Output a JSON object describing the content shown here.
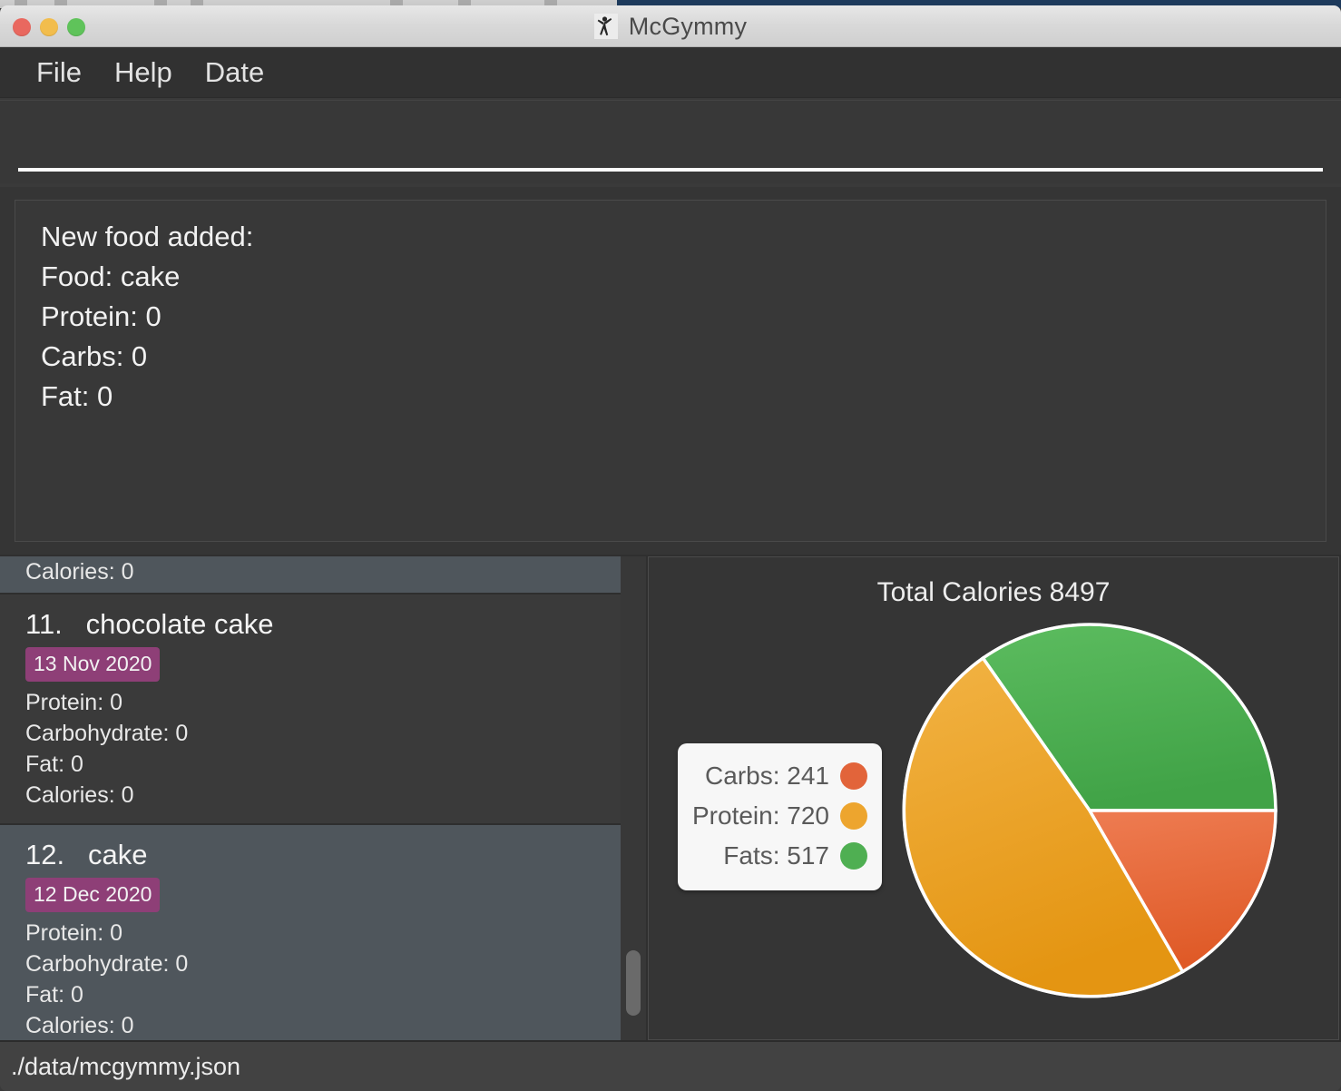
{
  "window": {
    "title": "McGymmy",
    "icon": "gym-person-icon",
    "traffic_lights": [
      "close",
      "minimize",
      "maximize"
    ]
  },
  "menubar": {
    "items": [
      {
        "label": "File"
      },
      {
        "label": "Help"
      },
      {
        "label": "Date"
      }
    ]
  },
  "command": {
    "value": "",
    "placeholder": ""
  },
  "result_display": {
    "lines": [
      "New food added:",
      "Food: cake",
      "Protein: 0",
      "Carbs: 0",
      "Fat: 0"
    ]
  },
  "food_list": {
    "partial_top_item": {
      "line": "Calories: 0"
    },
    "items": [
      {
        "index": "11.",
        "name": "chocolate cake",
        "date": "13 Nov 2020",
        "protein": "Protein: 0",
        "carbohydrate": "Carbohydrate: 0",
        "fat": "Fat: 0",
        "calories": "Calories: 0"
      },
      {
        "index": "12.",
        "name": "cake",
        "date": "12 Dec 2020",
        "protein": "Protein: 0",
        "carbohydrate": "Carbohydrate: 0",
        "fat": "Fat: 0",
        "calories": "Calories: 0"
      }
    ]
  },
  "statusbar": {
    "file_path": "./data/mcgymmy.json"
  },
  "colors": {
    "carbs": "#E2643A",
    "protein": "#EDA52E",
    "fats": "#4FAF52",
    "badge": "#8E3F77",
    "panel_bg": "#353535",
    "window_bg": "#383838"
  },
  "chart_data": {
    "type": "pie",
    "title": "Total Calories 8497",
    "total_calories": 8497,
    "categories": [
      "Carbs",
      "Protein",
      "Fats"
    ],
    "values": [
      241,
      720,
      517
    ],
    "labels": [
      "Carbs: 241",
      "Protein: 720",
      "Fats: 517"
    ],
    "colors": [
      "#E2643A",
      "#EDA52E",
      "#4FAF52"
    ],
    "legend_position": "left",
    "slice_angles_deg": {
      "Fats": {
        "start": 0,
        "end": 125
      },
      "Protein": {
        "start": 125,
        "end": 300
      },
      "Carbs": {
        "start": 300,
        "end": 360
      }
    },
    "grid": false
  }
}
